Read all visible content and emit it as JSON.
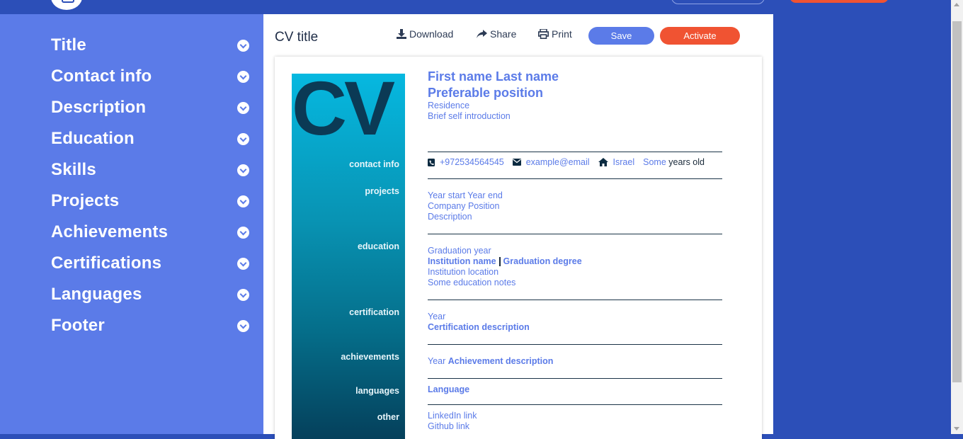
{
  "sidebar": {
    "items": [
      {
        "label": "Title"
      },
      {
        "label": "Contact info"
      },
      {
        "label": "Description"
      },
      {
        "label": "Education"
      },
      {
        "label": "Skills"
      },
      {
        "label": "Projects"
      },
      {
        "label": "Achievements"
      },
      {
        "label": "Certifications"
      },
      {
        "label": "Languages"
      },
      {
        "label": "Footer"
      }
    ]
  },
  "toolbar": {
    "cv_title": "CV title",
    "download": "Download",
    "share": "Share",
    "print": "Print",
    "save": "Save",
    "activate": "Activate"
  },
  "cv": {
    "logo_text": "CV",
    "name": "First name Last name",
    "position": "Preferable position",
    "residence": "Residence",
    "intro": "Brief self introduction",
    "sections": {
      "contact": "contact info",
      "projects": "projects",
      "education": "education",
      "certification": "certification",
      "achievements": "achievements",
      "languages": "languages",
      "other": "other"
    },
    "contact": {
      "phone": "+972534564545",
      "email": "example@email",
      "location": "Israel",
      "age_prefix": "Some",
      "age_suffix": "years old"
    },
    "projects": {
      "years": "Year start Year end",
      "company": "Company Position",
      "description": "Description"
    },
    "education": {
      "year": "Graduation year",
      "institution": "Institution name",
      "degree": "Graduation degree",
      "location": "Institution location",
      "notes": "Some education notes"
    },
    "certification": {
      "year": "Year",
      "description": "Certification description"
    },
    "achievements": {
      "year": "Year",
      "description": "Achievement description"
    },
    "languages": {
      "language": "Language"
    },
    "other": {
      "linkedin": "LinkedIn link",
      "github": "Github link"
    }
  },
  "colors": {
    "accent": "#5b7be8",
    "header_blue": "#2c4fb8",
    "orange": "#f05332",
    "dark": "#0b3a55"
  }
}
